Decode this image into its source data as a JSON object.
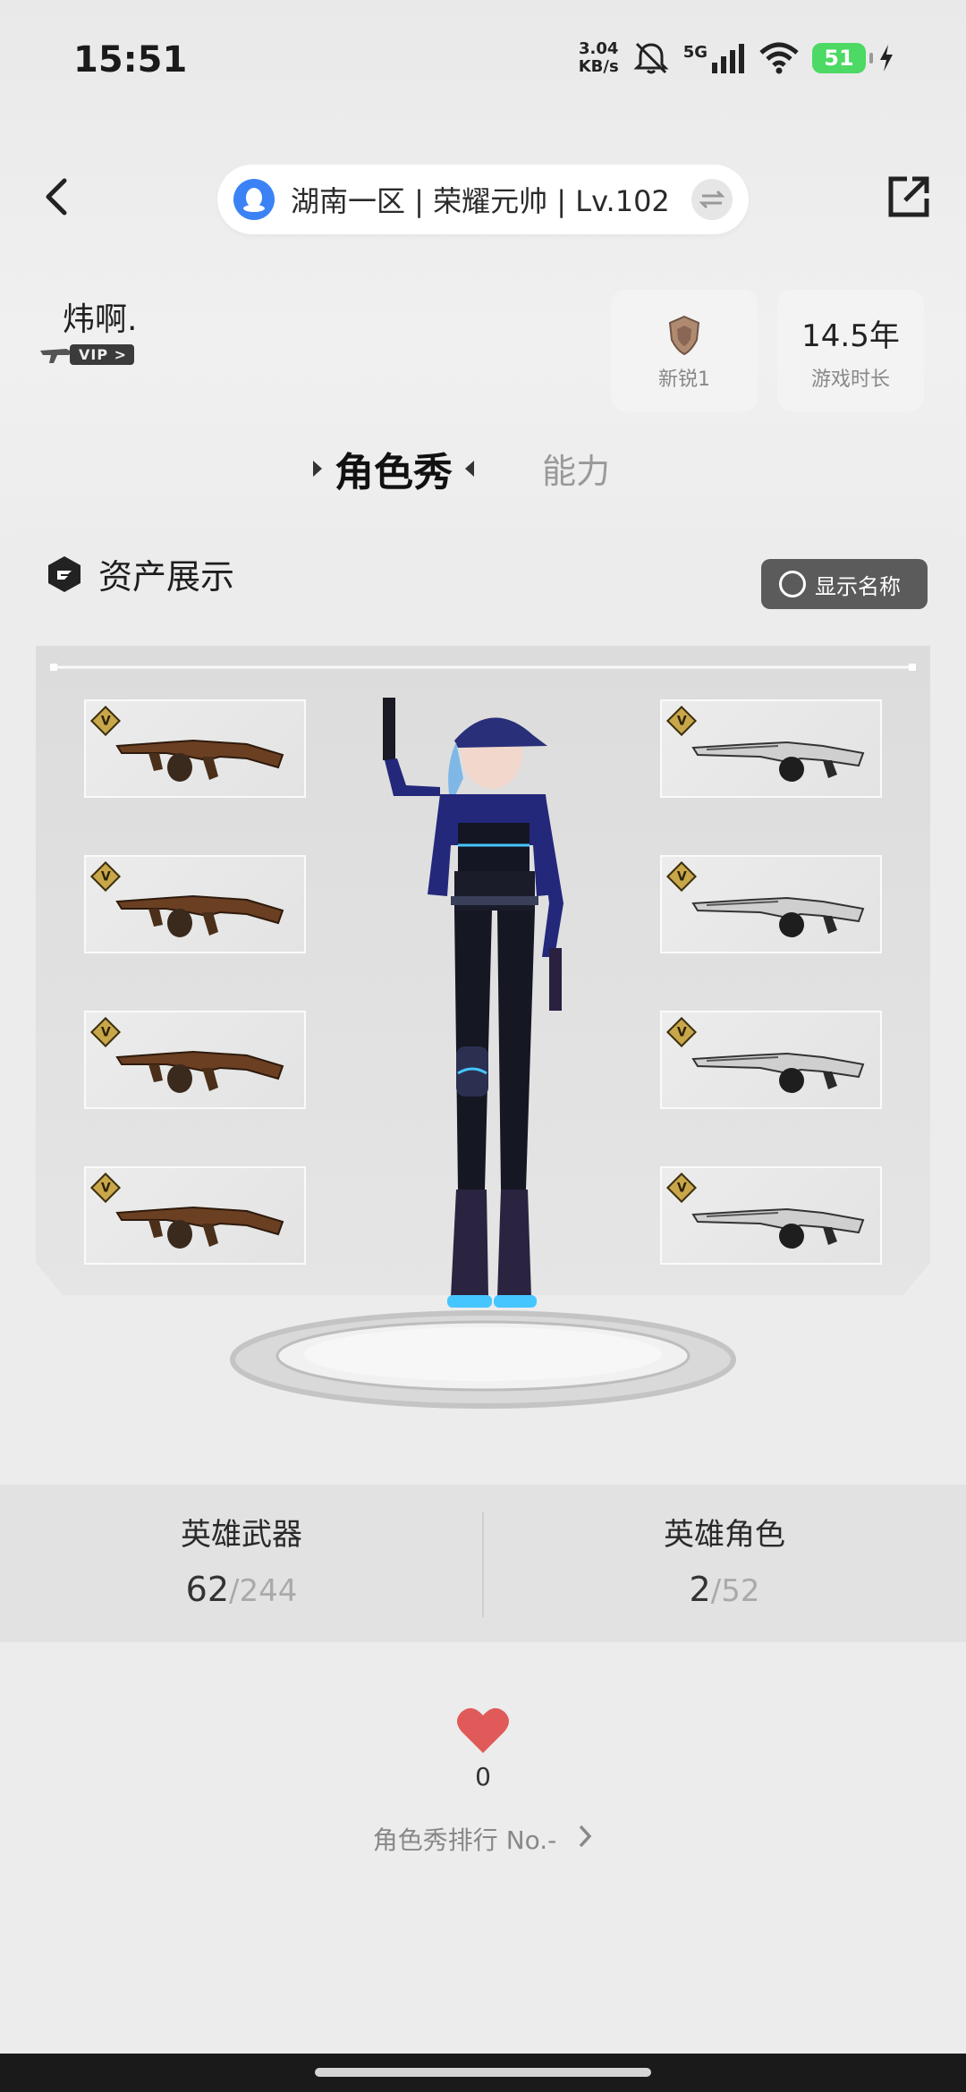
{
  "status_bar": {
    "time": "15:51",
    "net_speed_value": "3.04",
    "net_speed_unit": "KB/s",
    "network": "5G",
    "battery": "51"
  },
  "header": {
    "server_info": "湖南一区 | 荣耀元帅 | Lv.102"
  },
  "profile": {
    "name": "炜啊.",
    "vip_label": "VIP >",
    "rank_label": "新锐1",
    "play_time_value": "14.5年",
    "play_time_label": "游戏时长"
  },
  "tabs": {
    "active": "角色秀",
    "inactive": "能力"
  },
  "assets": {
    "title": "资产展示",
    "toggle_label": "显示名称",
    "weapon_badge": "V"
  },
  "counts": {
    "hero_weapons_label": "英雄武器",
    "hero_weapons_owned": "62",
    "hero_weapons_total": "/244",
    "hero_roles_label": "英雄角色",
    "hero_roles_owned": "2",
    "hero_roles_total": "/52"
  },
  "likes": {
    "count": "0",
    "ranking_label": "角色秀排行 No.-"
  },
  "colors": {
    "accent_blue": "#3b82f6",
    "heart_red": "#e05a5a",
    "battery_green": "#4cd964",
    "gold_badge": "#c9a64a"
  }
}
